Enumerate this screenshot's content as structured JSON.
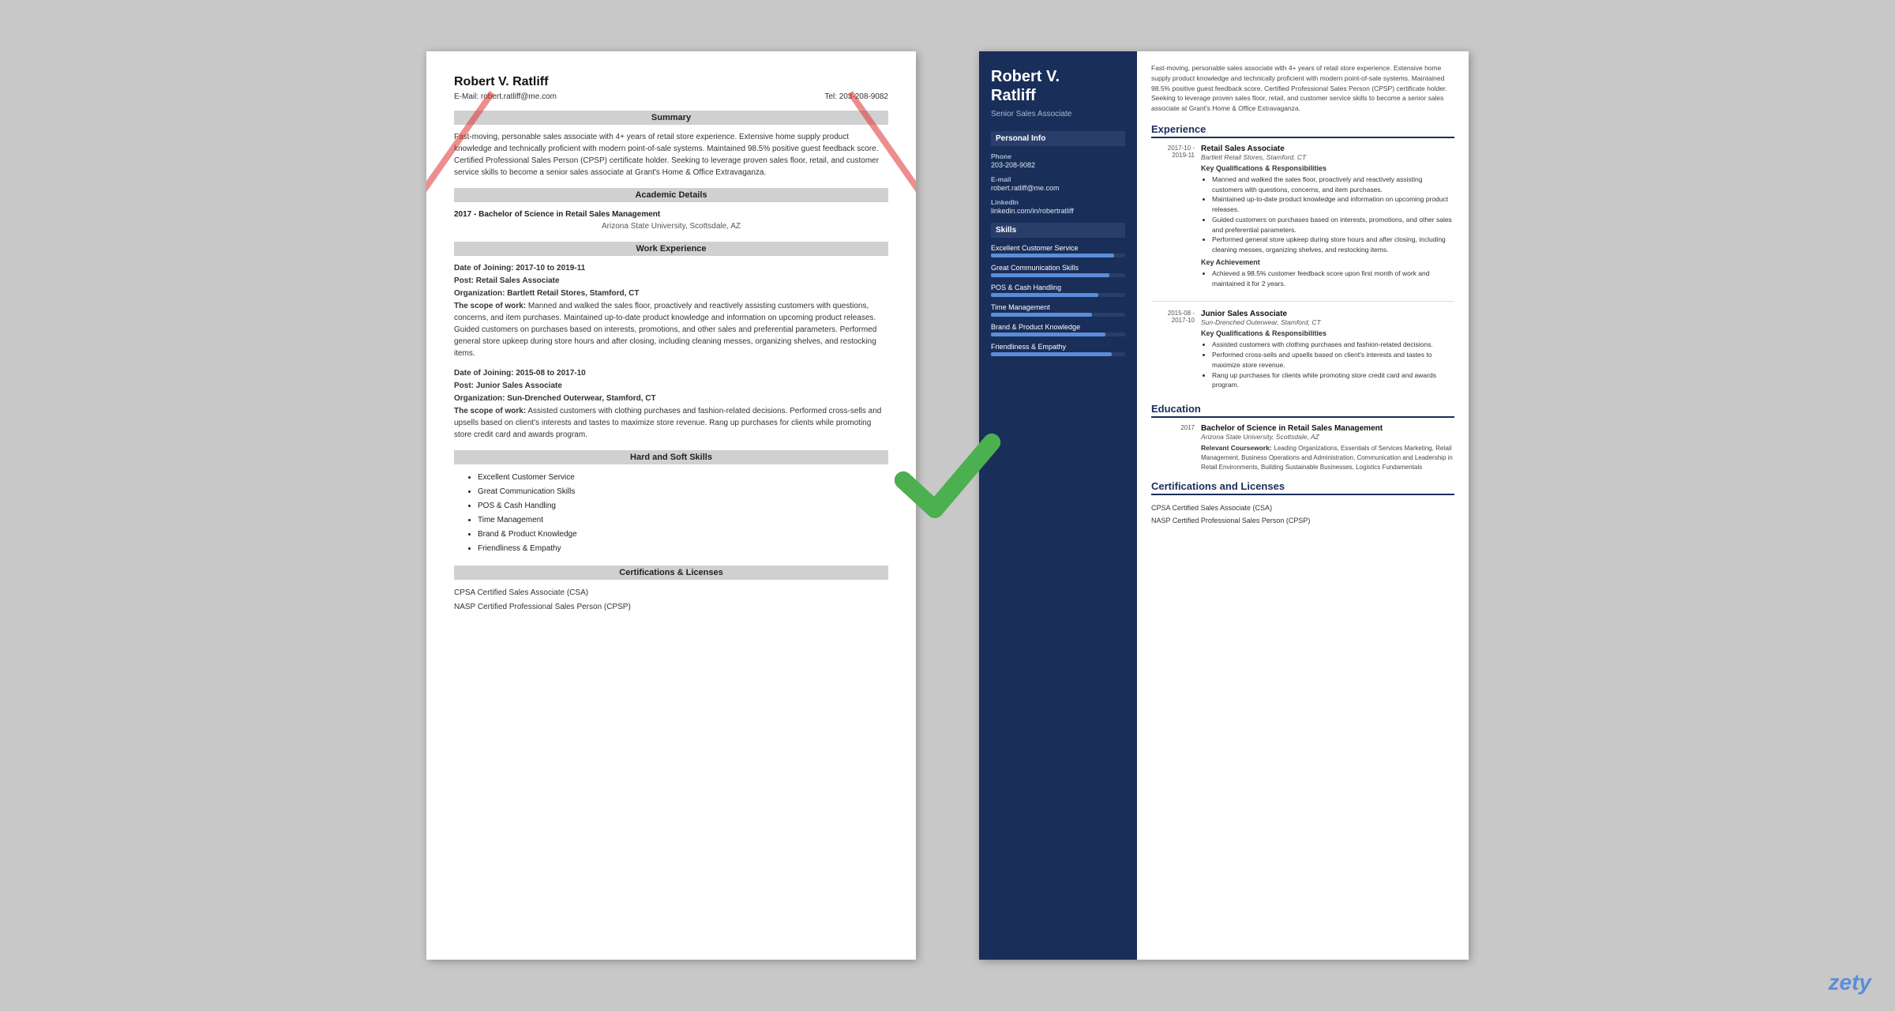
{
  "left_resume": {
    "name": "Robert V. Ratliff",
    "email": "E-Mail: robert.ratliff@me.com",
    "tel": "Tel: 203-208-9082",
    "sections": {
      "summary_title": "Summary",
      "summary_text": "Fast-moving, personable sales associate with 4+ years of retail store experience. Extensive home supply product knowledge and technically proficient with modern point-of-sale systems. Maintained 98.5% positive guest feedback score. Certified Professional Sales Person (CPSP) certificate holder. Seeking to leverage proven sales floor, retail, and customer service skills to become a senior sales associate at Grant's Home & Office Extravaganza.",
      "academic_title": "Academic Details",
      "academic_entry": "2017 - Bachelor of Science in Retail Sales Management",
      "academic_school": "Arizona State University, Scottsdale, AZ",
      "work_title": "Work Experience",
      "work_entries": [
        {
          "dates": "Date of Joining: 2017-10 to 2019-11",
          "post": "Post: Retail Sales Associate",
          "org": "Organization: Bartlett Retail Stores, Stamford, CT",
          "scope_label": "The scope of work:",
          "scope": "Manned and walked the sales floor, proactively and reactively assisting customers with questions, concerns, and item purchases. Maintained up-to-date product knowledge and information on upcoming product releases. Guided customers on purchases based on interests, promotions, and other sales and preferential parameters. Performed general store upkeep during store hours and after closing, including cleaning messes, organizing shelves, and restocking items."
        },
        {
          "dates": "Date of Joining: 2015-08 to 2017-10",
          "post": "Post: Junior Sales Associate",
          "org": "Organization: Sun-Drenched Outerwear, Stamford, CT",
          "scope_label": "The scope of work:",
          "scope": "Assisted customers with clothing purchases and fashion-related decisions. Performed cross-sells and upsells based on client's interests and tastes to maximize store revenue. Rang up purchases for clients while promoting store credit card and awards program."
        }
      ],
      "skills_title": "Hard and Soft Skills",
      "skills": [
        "Excellent Customer Service",
        "Great Communication Skills",
        "POS & Cash Handling",
        "Time Management",
        "Brand & Product Knowledge",
        "Friendliness & Empathy"
      ],
      "cert_title": "Certifications & Licenses",
      "certs": [
        "CPSA Certified Sales Associate (CSA)",
        "NASP Certified Professional Sales Person (CPSP)"
      ]
    }
  },
  "right_resume": {
    "name": "Robert V.\nRatliff",
    "title": "Senior Sales Associate",
    "personal_info_title": "Personal Info",
    "phone_label": "Phone",
    "phone": "203-208-9082",
    "email_label": "E-mail",
    "email": "robert.ratliff@me.com",
    "linkedin_label": "LinkedIn",
    "linkedin": "linkedin.com/in/robertratliff",
    "skills_title": "Skills",
    "skills": [
      {
        "name": "Excellent Customer Service",
        "pct": 92
      },
      {
        "name": "Great Communication Skills",
        "pct": 88
      },
      {
        "name": "POS & Cash Handling",
        "pct": 80
      },
      {
        "name": "Time Management",
        "pct": 75
      },
      {
        "name": "Brand & Product Knowledge",
        "pct": 85
      },
      {
        "name": "Friendliness & Empathy",
        "pct": 90
      }
    ],
    "summary": "Fast-moving, personable sales associate with 4+ years of retail store experience. Extensive home supply product knowledge and technically proficient with modern point-of-sale systems. Maintained 98.5% positive guest feedback score. Certified Professional Sales Person (CPSP) certificate holder. Seeking to leverage proven sales floor, retail, and customer service skills to become a senior sales associate at Grant's Home & Office Extravaganza.",
    "experience_title": "Experience",
    "experiences": [
      {
        "dates": "2017-10 -\n2019-11",
        "job_title": "Retail Sales Associate",
        "company": "Bartlett Retail Stores, Stamford, CT",
        "qualif_label": "Key Qualifications & Responsibilities",
        "bullets": [
          "Manned and walked the sales floor, proactively and reactively assisting customers with questions, concerns, and item purchases.",
          "Maintained up-to-date product knowledge and information on upcoming product releases.",
          "Guided customers on purchases based on interests, promotions, and other sales and preferential parameters.",
          "Performed general store upkeep during store hours and after closing, including cleaning messes, organizing shelves, and restocking items."
        ],
        "achievement_label": "Key Achievement",
        "achievement": "Achieved a 98.5% customer feedback score upon first month of work and maintained it for 2 years."
      },
      {
        "dates": "2015-08 -\n2017-10",
        "job_title": "Junior Sales Associate",
        "company": "Sun-Drenched Outerwear, Stamford, CT",
        "qualif_label": "Key Qualifications & Responsibilities",
        "bullets": [
          "Assisted customers with clothing purchases and fashion-related decisions.",
          "Performed cross-sells and upsells based on client's interests and tastes to maximize store revenue.",
          "Rang up purchases for clients while promoting store credit card and awards program."
        ]
      }
    ],
    "education_title": "Education",
    "education": [
      {
        "year": "2017",
        "degree": "Bachelor of Science in Retail Sales Management",
        "school": "Arizona State University, Scottsdale, AZ",
        "coursework_label": "Relevant Coursework:",
        "coursework": "Leading Organizations, Essentials of Services Marketing, Retail Management, Business Operations and Administration, Communication and Leadership in Retail Environments, Building Sustainable Businesses, Logistics Fundamentals"
      }
    ],
    "cert_title": "Certifications and Licenses",
    "certs": [
      "CPSA Certified Sales Associate (CSA)",
      "NASP Certified Professional Sales Person (CPSP)"
    ]
  },
  "watermark": "zety"
}
